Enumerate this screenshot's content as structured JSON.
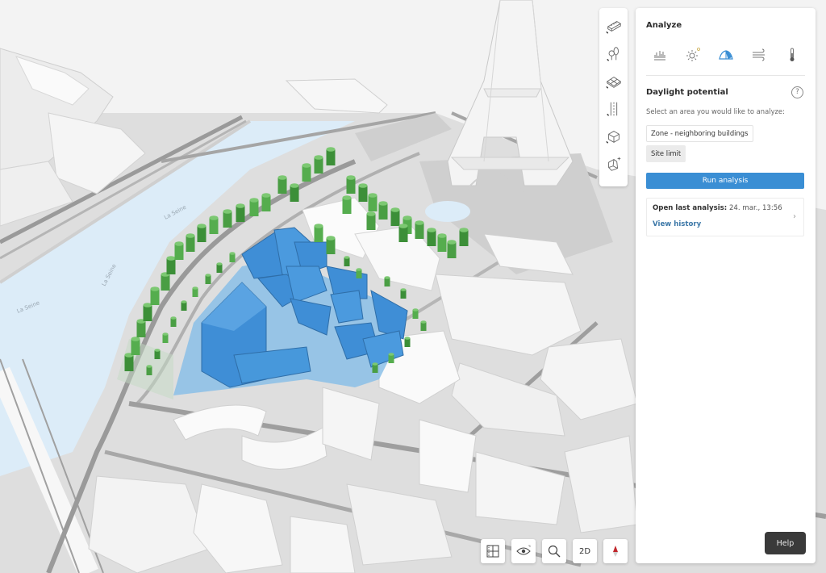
{
  "map": {
    "river_labels": [
      "La Seine",
      "La Seine",
      "La Seine"
    ],
    "colors": {
      "water": "#dcecf8",
      "site": "#3f8ed6",
      "site_ground": "#8bbfe8",
      "trees": "#4fa84a",
      "buildings": "#ffffff",
      "ground": "#dadada",
      "roads": "#9a9a9a"
    }
  },
  "left_toolbar": {
    "tools": [
      {
        "name": "buildings-tool",
        "icon": "building-block-icon"
      },
      {
        "name": "trees-tool",
        "icon": "trees-icon"
      },
      {
        "name": "surfaces-tool",
        "icon": "surface-icon"
      },
      {
        "name": "roads-tool",
        "icon": "road-lanes-icon"
      },
      {
        "name": "volume-tool",
        "icon": "volume-box-icon"
      },
      {
        "name": "add-shape-tool",
        "icon": "add-shape-icon"
      }
    ]
  },
  "panel": {
    "title": "Analyze",
    "tabs": [
      {
        "id": "statistics",
        "icon": "bar-chart-icon",
        "active": false
      },
      {
        "id": "sun",
        "icon": "sun-icon",
        "active": false
      },
      {
        "id": "daylight",
        "icon": "daylight-dome-icon",
        "active": true
      },
      {
        "id": "wind",
        "icon": "wind-icon",
        "active": false
      },
      {
        "id": "temperature",
        "icon": "thermometer-icon",
        "active": false
      }
    ],
    "section_title": "Daylight potential",
    "help_glyph": "?",
    "instruction": "Select an area you would like to analyze:",
    "area_options": [
      {
        "label": "Zone - neighboring buildings",
        "selected": false
      },
      {
        "label": "Site limit",
        "selected": true
      }
    ],
    "run_button": "Run analysis",
    "last_analysis": {
      "label": "Open last analysis:",
      "value": "24. mar., 13:56",
      "history_link": "View history",
      "chevron": "›"
    },
    "accent_color": "#3a8ed4"
  },
  "bottom_toolbar": {
    "buttons": [
      {
        "name": "grid-view-button",
        "icon": "grid-icon"
      },
      {
        "name": "visibility-button",
        "icon": "eye-icon"
      },
      {
        "name": "search-button",
        "icon": "search-icon"
      },
      {
        "name": "2d-toggle-button",
        "label": "2D"
      },
      {
        "name": "compass-button",
        "icon": "compass-icon"
      }
    ]
  },
  "help_button": "Help"
}
